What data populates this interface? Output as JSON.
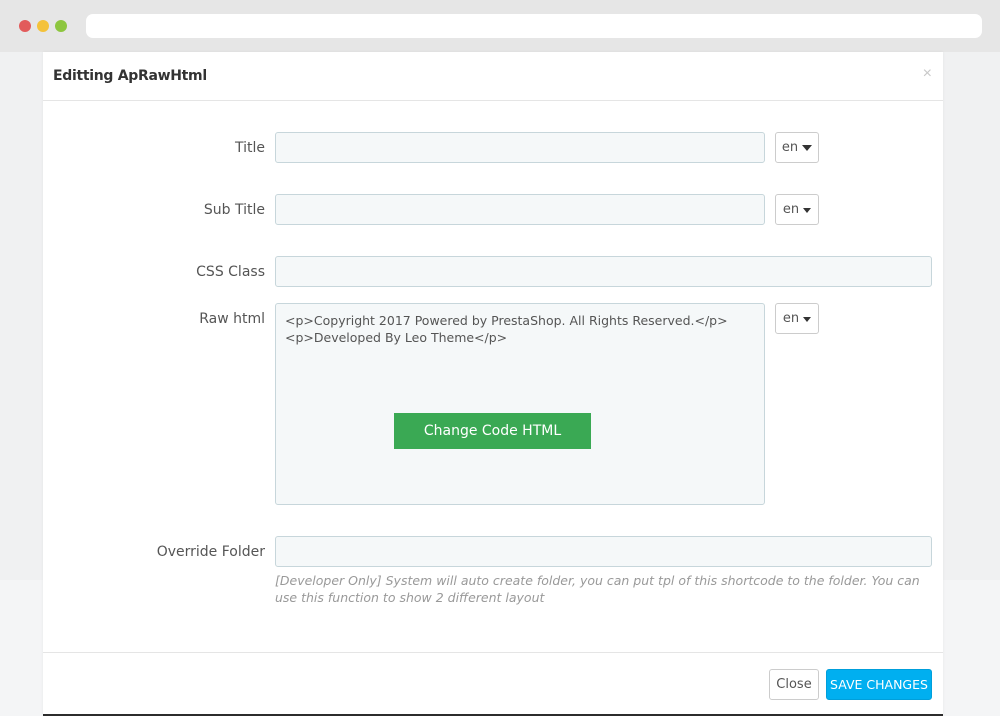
{
  "modal": {
    "title": "Editting ApRawHtml",
    "close_symbol": "×"
  },
  "form": {
    "title": {
      "label": "Title",
      "value": "",
      "lang": "en"
    },
    "sub_title": {
      "label": "Sub Title",
      "value": "",
      "lang": "en"
    },
    "css_class": {
      "label": "CSS Class",
      "value": ""
    },
    "raw_html": {
      "label": "Raw html",
      "lines": [
        "<p>Copyright 2017 Powered by PrestaShop. All Rights Reserved.</p>",
        "<p>Developed By Leo Theme</p>"
      ],
      "lang": "en",
      "change_button": "Change Code HTML"
    },
    "override_folder": {
      "label": "Override Folder",
      "value": "",
      "help": "[Developer Only] System will auto create folder, you can put tpl of this shortcode to the folder. You can use this function to show 2 different layout"
    }
  },
  "footer": {
    "close_label": "Close",
    "save_label": "SAVE CHANGES"
  },
  "colors": {
    "save_button": "#00aff0",
    "change_code_button": "#3aa954",
    "field_background": "#f5f8f9"
  },
  "icons": {
    "lang_dropdown": "caret-down-icon",
    "modal_close": "close-icon"
  }
}
